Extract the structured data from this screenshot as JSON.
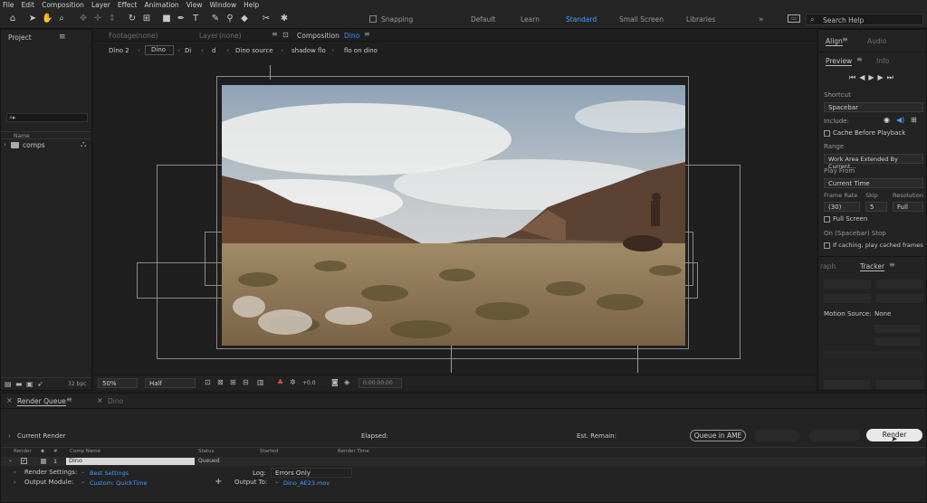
{
  "menu": [
    "File",
    "Edit",
    "Composition",
    "Layer",
    "Effect",
    "Animation",
    "View",
    "Window",
    "Help"
  ],
  "toolbar": {
    "snapping_label": "Snapping",
    "search_placeholder": "Search Help"
  },
  "workspaces": [
    "Default",
    "Learn",
    "Standard",
    "Small Screen",
    "Libraries"
  ],
  "project_panel": {
    "title": "Project",
    "search_placeholder": "",
    "name_header": "Name",
    "items": [
      {
        "label": "comps"
      }
    ],
    "bpc": "32 bpc"
  },
  "viewer_tabs": {
    "footage": "Footage",
    "footage_val": "(none)",
    "layer": "Layer",
    "layer_val": "(none)",
    "composition": "Composition",
    "composition_val": "Dino"
  },
  "breadcrumbs": [
    "Dino 2",
    "Dino",
    "Di",
    "d",
    "Dino source",
    "shadow flo",
    "flo on dino"
  ],
  "viewer_footer": {
    "zoom": "50%",
    "resolution": "Half",
    "exposure": "+0.0",
    "timecode": "0:00:00:00"
  },
  "right_panel": {
    "tabs_top": [
      "Align",
      "Audio"
    ],
    "tabs_second": [
      "Preview",
      "Info"
    ],
    "shortcut_label": "Shortcut",
    "shortcut_value": "Spacebar",
    "include_label": "Include:",
    "cache_label": "Cache Before Playback",
    "range_label": "Range",
    "range_value": "Work Area Extended By Current...",
    "play_from_label": "Play From",
    "play_from_value": "Current Time",
    "frame_rate_label": "Frame Rate",
    "skip_label": "Skip",
    "resolution_label": "Resolution",
    "frame_rate_value": "(30)",
    "skip_value": "5",
    "resolution_value": "Full",
    "full_screen_label": "Full Screen",
    "on_stop_label": "On (Spacebar) Stop",
    "cached_label": "If caching, play cached frames",
    "tracker_tabs": [
      "raph",
      "Tracker"
    ],
    "motion_source_label": "Motion Source:",
    "motion_source_value": "None"
  },
  "render_queue": {
    "tabs": [
      "Render Queue",
      "Dino"
    ],
    "current_render": "Current Render",
    "elapsed": "Elapsed:",
    "est_remain": "Est. Remain:",
    "queue_ame": "Queue in AME",
    "render_button": "Render",
    "columns": [
      "Render",
      "#",
      "Comp Name",
      "Status",
      "Started",
      "Render Time"
    ],
    "row": {
      "num": "1",
      "comp": "Dino",
      "status": "Queued"
    },
    "render_settings_label": "Render Settings:",
    "render_settings_value": "Best Settings",
    "output_module_label": "Output Module:",
    "output_module_value": "Custom: QuickTime",
    "log_label": "Log:",
    "log_value": "Errors Only",
    "output_to_label": "Output To:",
    "output_to_value": "Dino_AE23.mov"
  }
}
